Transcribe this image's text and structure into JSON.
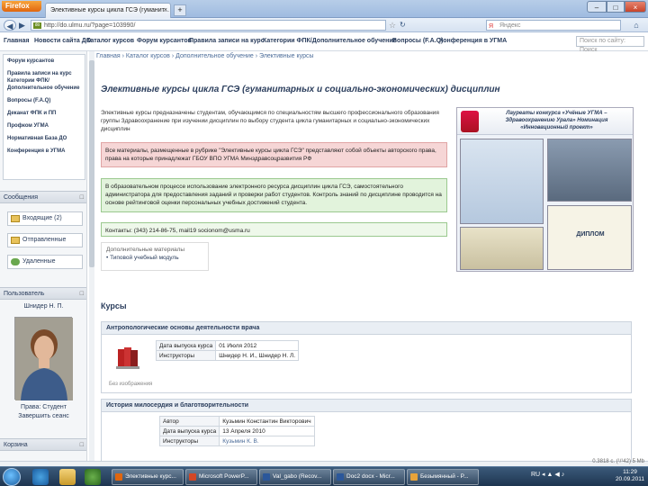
{
  "browser": {
    "app_button": "Firefox",
    "tab_title": "Элективные курсы цикла ГСЭ (гуманит...",
    "tab_close": "×",
    "new_tab": "+",
    "url": "http://do.ulmu.ru/?page=103990/",
    "web_search_placeholder": "Яндекс",
    "window_min": "–",
    "window_max": "□",
    "window_close": "×"
  },
  "site_menu": {
    "items": [
      "Главная",
      "Новости сайта ДО",
      "Каталог курсов",
      "Форум курсантов",
      "Правила записи на курс",
      "Категории ФПК/Дополнительное обучение",
      "Вопросы (F.A.Q)",
      "Конференция в УГМА"
    ],
    "search_placeholder": "Поиск по сайту: Поиск"
  },
  "sidebar": {
    "links": [
      "Форум курсантов",
      "Правила записи на курс Категории ФПК/Дополнительное обучение",
      "Вопросы (F.A.Q)",
      "Деканат ФПК и ПП",
      "Профком УГМА",
      "Нормативная База ДО",
      "Конференция в УГМА"
    ],
    "messages_block": {
      "title": "Сообщения",
      "inbox": "Входящие (2)",
      "sent": "Отправленные",
      "deleted": "Удаленные"
    },
    "user_block": {
      "title": "Пользователь",
      "name": "Шнидер Н. П.",
      "role": "Права: Студент",
      "logout": "Завершить сеанс"
    },
    "cart_block": {
      "title": "Корзина"
    }
  },
  "main": {
    "breadcrumb": "Главная › Каталог курсов › Дополнительное обучение › Элективные курсы",
    "title": "Элективные курсы цикла ГСЭ (гуманитарных и социально-экономических) дисциплин",
    "intro": "Элективные курсы предназначены студентам, обучающимся по специальностям высшего профессионального образования группы Здравоохранение при изучении дисциплин по выбору студента цикла гуманитарных и социально-экономических дисциплин",
    "notice_red": "Все материалы, размещенные в рубрике \"Элективные курсы цикла ГСЭ\" представляют собой объекты авторского права, права на которые принадлежат ГБОУ ВПО УГМА Минздравсоцразвития РФ",
    "notice_green": "В образовательном процессе использование электронного ресурса дисциплин цикла ГСЭ, самостоятельного администратора для предоставления заданий и проверки работ студентов. Контроль знаний по дисциплине проводится на основе рейтинговой оценки персональных учебных достижений студента.",
    "contacts": "Контакты: (343) 214-86-75, mail19 socionom@usma.ru",
    "materials_title": "Дополнительные материалы",
    "materials_item": "• Типовой учебный модуль",
    "banner_title": "Лауреаты конкурса «Учёные УГМА – Здравоохранению Урала» Номинация «Инновационный проект»",
    "banner_diploma": "ДИПЛОМ",
    "courses_heading": "Курсы",
    "courses": [
      {
        "title": "Антропологические основы деятельности врача",
        "rows": [
          [
            "Дата выпуска курса",
            "01 Июля 2012"
          ],
          [
            "Инструкторы",
            "Шнидер Н. И., Шнидер Н. Л."
          ]
        ],
        "extra": "Без изображения"
      },
      {
        "title": "История милосердия и благотворительности",
        "rows": [
          [
            "Автор",
            "Кузьмин Константин Викторович"
          ],
          [
            "Дата выпуска курса",
            "13 Апреля 2010"
          ],
          [
            "Инструкторы",
            "Кузьмин К. В."
          ]
        ]
      }
    ]
  },
  "status_bar": "0.3818 с. (¹/¹42) 5 Mb",
  "taskbar": {
    "tasks": [
      "Элективные курс...",
      "Microsoft PowerP...",
      "Val_gabo (Recov...",
      "Doc2 docx - Micr...",
      "Безымянный - P..."
    ],
    "tray": "RU ◂ ▲ ◀ ♪",
    "time": "11:29",
    "date": "20.09.2011"
  },
  "colors": {
    "accent": "#2a3d5c",
    "link": "#4b6c99",
    "red_notice": "#f6d6d6",
    "green_notice": "#e2f3dc"
  }
}
